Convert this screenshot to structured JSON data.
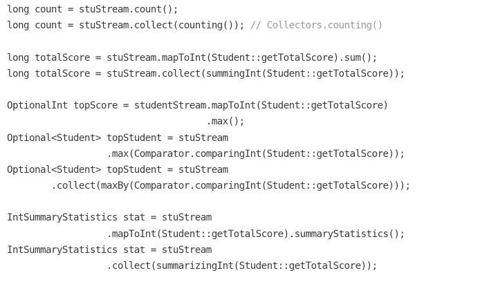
{
  "code": {
    "line_01": "long count = stuStream.count();",
    "line_02_code": "long count = stuStream.collect(counting()); ",
    "line_02_comment": "// Collectors.counting()",
    "line_04": "long totalScore = stuStream.mapToInt(Student::getTotalScore).sum();",
    "line_05": "long totalScore = stuStream.collect(summingInt(Student::getTotalScore));",
    "line_07": "OptionalInt topScore = studentStream.mapToInt(Student::getTotalScore)",
    "line_08": "                                    .max();",
    "line_09": "Optional<Student> topStudent = stuStream",
    "line_10": "                  .max(Comparator.comparingInt(Student::getTotalScore));",
    "line_11": "Optional<Student> topStudent = stuStream",
    "line_12": "        .collect(maxBy(Comparator.comparingInt(Student::getTotalScore)));",
    "line_14": "IntSummaryStatistics stat = stuStream",
    "line_15": "                  .mapToInt(Student::getTotalScore).summaryStatistics();",
    "line_16": "IntSummaryStatistics stat = stuStream",
    "line_17": "                  .collect(summarizingInt(Student::getTotalScore));"
  }
}
